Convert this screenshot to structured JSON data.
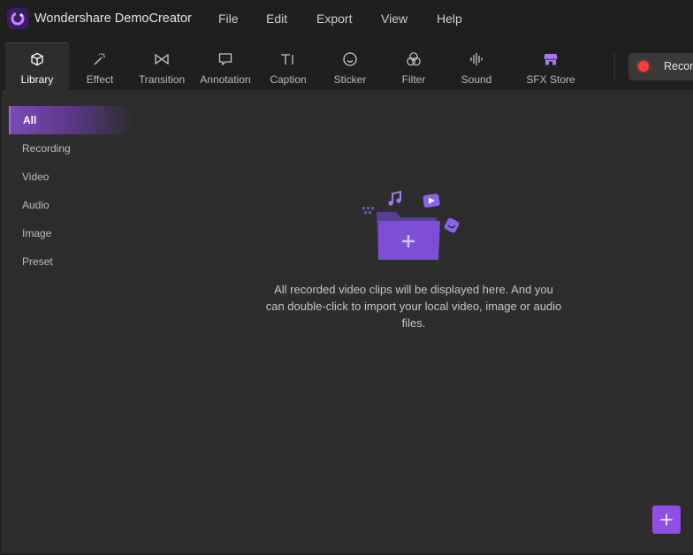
{
  "app": {
    "title": "Wondershare DemoCreator",
    "logo_icon": "democreator-logo-icon"
  },
  "menu": {
    "items": [
      {
        "label": "File"
      },
      {
        "label": "Edit"
      },
      {
        "label": "Export"
      },
      {
        "label": "View"
      },
      {
        "label": "Help"
      }
    ]
  },
  "toolbar": {
    "tabs": [
      {
        "label": "Library",
        "icon": "cube-icon",
        "active": true
      },
      {
        "label": "Effect",
        "icon": "magic-wand-icon"
      },
      {
        "label": "Transition",
        "icon": "bowtie-icon"
      },
      {
        "label": "Annotation",
        "icon": "speech-bubble-icon"
      },
      {
        "label": "Caption",
        "icon": "text-cursor-icon"
      },
      {
        "label": "Sticker",
        "icon": "smiley-icon"
      },
      {
        "label": "Filter",
        "icon": "circles-icon"
      },
      {
        "label": "Sound",
        "icon": "waveform-icon"
      },
      {
        "label": "SFX Store",
        "icon": "store-icon"
      }
    ],
    "record_label": "Recorc"
  },
  "sidebar": {
    "items": [
      {
        "label": "All",
        "active": true
      },
      {
        "label": "Recording"
      },
      {
        "label": "Video"
      },
      {
        "label": "Audio"
      },
      {
        "label": "Image"
      },
      {
        "label": "Preset"
      }
    ]
  },
  "empty_state": {
    "message": "All recorded video clips will be displayed here. And you can double-click to import your local video, image or audio files.",
    "illustration_icon": "folder-add-icon"
  },
  "colors": {
    "accent": "#8f4fe6",
    "background": "#1f1f1f",
    "panel": "#2d2d2d",
    "record": "#ff3b3b"
  }
}
